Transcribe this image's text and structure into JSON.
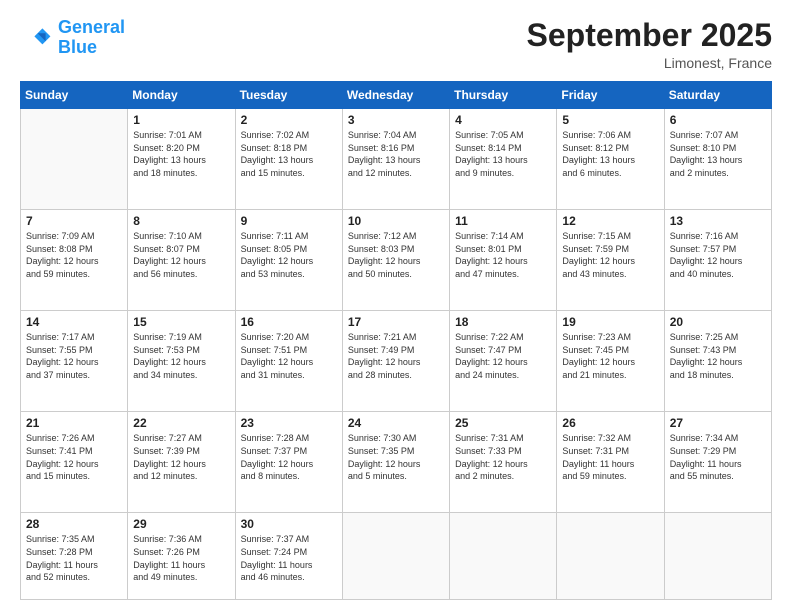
{
  "logo": {
    "line1": "General",
    "line2": "Blue"
  },
  "title": "September 2025",
  "location": "Limonest, France",
  "days_header": [
    "Sunday",
    "Monday",
    "Tuesday",
    "Wednesday",
    "Thursday",
    "Friday",
    "Saturday"
  ],
  "weeks": [
    [
      {
        "day": "",
        "info": ""
      },
      {
        "day": "1",
        "info": "Sunrise: 7:01 AM\nSunset: 8:20 PM\nDaylight: 13 hours\nand 18 minutes."
      },
      {
        "day": "2",
        "info": "Sunrise: 7:02 AM\nSunset: 8:18 PM\nDaylight: 13 hours\nand 15 minutes."
      },
      {
        "day": "3",
        "info": "Sunrise: 7:04 AM\nSunset: 8:16 PM\nDaylight: 13 hours\nand 12 minutes."
      },
      {
        "day": "4",
        "info": "Sunrise: 7:05 AM\nSunset: 8:14 PM\nDaylight: 13 hours\nand 9 minutes."
      },
      {
        "day": "5",
        "info": "Sunrise: 7:06 AM\nSunset: 8:12 PM\nDaylight: 13 hours\nand 6 minutes."
      },
      {
        "day": "6",
        "info": "Sunrise: 7:07 AM\nSunset: 8:10 PM\nDaylight: 13 hours\nand 2 minutes."
      }
    ],
    [
      {
        "day": "7",
        "info": "Sunrise: 7:09 AM\nSunset: 8:08 PM\nDaylight: 12 hours\nand 59 minutes."
      },
      {
        "day": "8",
        "info": "Sunrise: 7:10 AM\nSunset: 8:07 PM\nDaylight: 12 hours\nand 56 minutes."
      },
      {
        "day": "9",
        "info": "Sunrise: 7:11 AM\nSunset: 8:05 PM\nDaylight: 12 hours\nand 53 minutes."
      },
      {
        "day": "10",
        "info": "Sunrise: 7:12 AM\nSunset: 8:03 PM\nDaylight: 12 hours\nand 50 minutes."
      },
      {
        "day": "11",
        "info": "Sunrise: 7:14 AM\nSunset: 8:01 PM\nDaylight: 12 hours\nand 47 minutes."
      },
      {
        "day": "12",
        "info": "Sunrise: 7:15 AM\nSunset: 7:59 PM\nDaylight: 12 hours\nand 43 minutes."
      },
      {
        "day": "13",
        "info": "Sunrise: 7:16 AM\nSunset: 7:57 PM\nDaylight: 12 hours\nand 40 minutes."
      }
    ],
    [
      {
        "day": "14",
        "info": "Sunrise: 7:17 AM\nSunset: 7:55 PM\nDaylight: 12 hours\nand 37 minutes."
      },
      {
        "day": "15",
        "info": "Sunrise: 7:19 AM\nSunset: 7:53 PM\nDaylight: 12 hours\nand 34 minutes."
      },
      {
        "day": "16",
        "info": "Sunrise: 7:20 AM\nSunset: 7:51 PM\nDaylight: 12 hours\nand 31 minutes."
      },
      {
        "day": "17",
        "info": "Sunrise: 7:21 AM\nSunset: 7:49 PM\nDaylight: 12 hours\nand 28 minutes."
      },
      {
        "day": "18",
        "info": "Sunrise: 7:22 AM\nSunset: 7:47 PM\nDaylight: 12 hours\nand 24 minutes."
      },
      {
        "day": "19",
        "info": "Sunrise: 7:23 AM\nSunset: 7:45 PM\nDaylight: 12 hours\nand 21 minutes."
      },
      {
        "day": "20",
        "info": "Sunrise: 7:25 AM\nSunset: 7:43 PM\nDaylight: 12 hours\nand 18 minutes."
      }
    ],
    [
      {
        "day": "21",
        "info": "Sunrise: 7:26 AM\nSunset: 7:41 PM\nDaylight: 12 hours\nand 15 minutes."
      },
      {
        "day": "22",
        "info": "Sunrise: 7:27 AM\nSunset: 7:39 PM\nDaylight: 12 hours\nand 12 minutes."
      },
      {
        "day": "23",
        "info": "Sunrise: 7:28 AM\nSunset: 7:37 PM\nDaylight: 12 hours\nand 8 minutes."
      },
      {
        "day": "24",
        "info": "Sunrise: 7:30 AM\nSunset: 7:35 PM\nDaylight: 12 hours\nand 5 minutes."
      },
      {
        "day": "25",
        "info": "Sunrise: 7:31 AM\nSunset: 7:33 PM\nDaylight: 12 hours\nand 2 minutes."
      },
      {
        "day": "26",
        "info": "Sunrise: 7:32 AM\nSunset: 7:31 PM\nDaylight: 11 hours\nand 59 minutes."
      },
      {
        "day": "27",
        "info": "Sunrise: 7:34 AM\nSunset: 7:29 PM\nDaylight: 11 hours\nand 55 minutes."
      }
    ],
    [
      {
        "day": "28",
        "info": "Sunrise: 7:35 AM\nSunset: 7:28 PM\nDaylight: 11 hours\nand 52 minutes."
      },
      {
        "day": "29",
        "info": "Sunrise: 7:36 AM\nSunset: 7:26 PM\nDaylight: 11 hours\nand 49 minutes."
      },
      {
        "day": "30",
        "info": "Sunrise: 7:37 AM\nSunset: 7:24 PM\nDaylight: 11 hours\nand 46 minutes."
      },
      {
        "day": "",
        "info": ""
      },
      {
        "day": "",
        "info": ""
      },
      {
        "day": "",
        "info": ""
      },
      {
        "day": "",
        "info": ""
      }
    ]
  ]
}
